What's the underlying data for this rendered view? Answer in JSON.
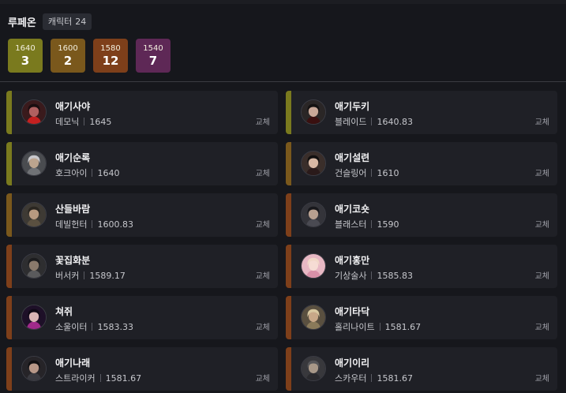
{
  "header": {
    "server_name": "루페온",
    "char_count_label": "캐릭터",
    "char_count": "24"
  },
  "tiers": [
    {
      "level": "1640",
      "count": "3",
      "color": "#7a7a1e"
    },
    {
      "level": "1600",
      "count": "2",
      "color": "#7a581c"
    },
    {
      "level": "1580",
      "count": "12",
      "color": "#7e3f1a"
    },
    {
      "level": "1540",
      "count": "7",
      "color": "#5e2856"
    }
  ],
  "swap_label": "교체",
  "characters": [
    {
      "name": "애기사야",
      "class": "데모닉",
      "level": "1645",
      "tier_color": "#7a7a1e",
      "avatar": {
        "bg": "#3a1a1c",
        "hair": "#1a0e10",
        "face": "#b06060",
        "accent": "#c42020"
      }
    },
    {
      "name": "애기두키",
      "class": "블레이드",
      "level": "1640.83",
      "tier_color": "#7a7a1e",
      "avatar": {
        "bg": "#2a2626",
        "hair": "#141212",
        "face": "#c9a898",
        "accent": "#3a1010"
      }
    },
    {
      "name": "애기순록",
      "class": "호크아이",
      "level": "1640",
      "tier_color": "#7a7a1e",
      "avatar": {
        "bg": "#4a4c50",
        "hair": "#c8c8cc",
        "face": "#bca48e",
        "accent": "#707276"
      }
    },
    {
      "name": "애기설련",
      "class": "건슬링어",
      "level": "1610",
      "tier_color": "#7a581c",
      "avatar": {
        "bg": "#3a2e2a",
        "hair": "#121010",
        "face": "#d8b8a4",
        "accent": "#2a1a1a"
      }
    },
    {
      "name": "산들바람",
      "class": "데빌헌터",
      "level": "1600.83",
      "tier_color": "#7a581c",
      "avatar": {
        "bg": "#3e3a34",
        "hair": "#2a2620",
        "face": "#b89a80",
        "accent": "#5a5040"
      }
    },
    {
      "name": "애기코숏",
      "class": "블래스터",
      "level": "1590",
      "tier_color": "#7e3f1a",
      "avatar": {
        "bg": "#34343a",
        "hair": "#18181c",
        "face": "#b8a090",
        "accent": "#4a4a52"
      }
    },
    {
      "name": "꽃집화분",
      "class": "버서커",
      "level": "1589.17",
      "tier_color": "#7e3f1a",
      "avatar": {
        "bg": "#2e2e30",
        "hair": "#1c1c1e",
        "face": "#8a7a6c",
        "accent": "#5a5a5c"
      }
    },
    {
      "name": "애기홍만",
      "class": "기상술사",
      "level": "1585.83",
      "tier_color": "#7e3f1a",
      "avatar": {
        "bg": "#e8b8c4",
        "hair": "#f2d8c8",
        "face": "#f6dcd4",
        "accent": "#d890a8"
      }
    },
    {
      "name": "쳐쥐",
      "class": "소울이터",
      "level": "1583.33",
      "tier_color": "#7e3f1a",
      "avatar": {
        "bg": "#1e1028",
        "hair": "#0e0814",
        "face": "#d8b4b4",
        "accent": "#a02a8a"
      }
    },
    {
      "name": "애기타닥",
      "class": "홀리나이트",
      "level": "1581.67",
      "tier_color": "#7e3f1a",
      "avatar": {
        "bg": "#5a5040",
        "hair": "#d8c8a0",
        "face": "#c8a888",
        "accent": "#8a7a5a"
      }
    },
    {
      "name": "애기나래",
      "class": "스트라이커",
      "level": "1581.67",
      "tier_color": "#7e3f1a",
      "avatar": {
        "bg": "#262428",
        "hair": "#101012",
        "face": "#b89888",
        "accent": "#3a3a40"
      }
    },
    {
      "name": "애기이리",
      "class": "스카우터",
      "level": "1581.67",
      "tier_color": "#7e3f1a",
      "avatar": {
        "bg": "#38383c",
        "hair": "#555558",
        "face": "#a89888",
        "accent": "#2a2a2e"
      }
    }
  ]
}
